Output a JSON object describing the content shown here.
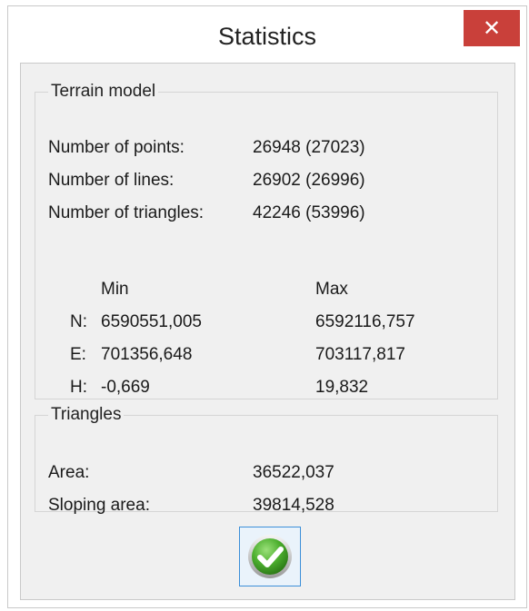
{
  "window": {
    "title": "Statistics",
    "close_glyph": "✕"
  },
  "terrain_model": {
    "legend": "Terrain model",
    "rows": [
      {
        "label": "Number of points:",
        "value": "26948 (27023)"
      },
      {
        "label": "Number of lines:",
        "value": "26902 (26996)"
      },
      {
        "label": "Number of triangles:",
        "value": "42246 (53996)"
      }
    ],
    "extents": {
      "min_header": "Min",
      "max_header": "Max",
      "rows": [
        {
          "axis": "N:",
          "min": "6590551,005",
          "max": "6592116,757"
        },
        {
          "axis": "E:",
          "min": "701356,648",
          "max": "703117,817"
        },
        {
          "axis": "H:",
          "min": "-0,669",
          "max": "19,832"
        }
      ]
    }
  },
  "triangles": {
    "legend": "Triangles",
    "rows": [
      {
        "label": "Area:",
        "value": "36522,037"
      },
      {
        "label": "Sloping area:",
        "value": "39814,528"
      }
    ]
  },
  "ok_button": {
    "icon": "checkmark-icon",
    "accent": "#4caf2e"
  },
  "colors": {
    "close_button": "#c9403a",
    "focus_border": "#3c8fd9",
    "panel_background": "#f0f0f0"
  }
}
